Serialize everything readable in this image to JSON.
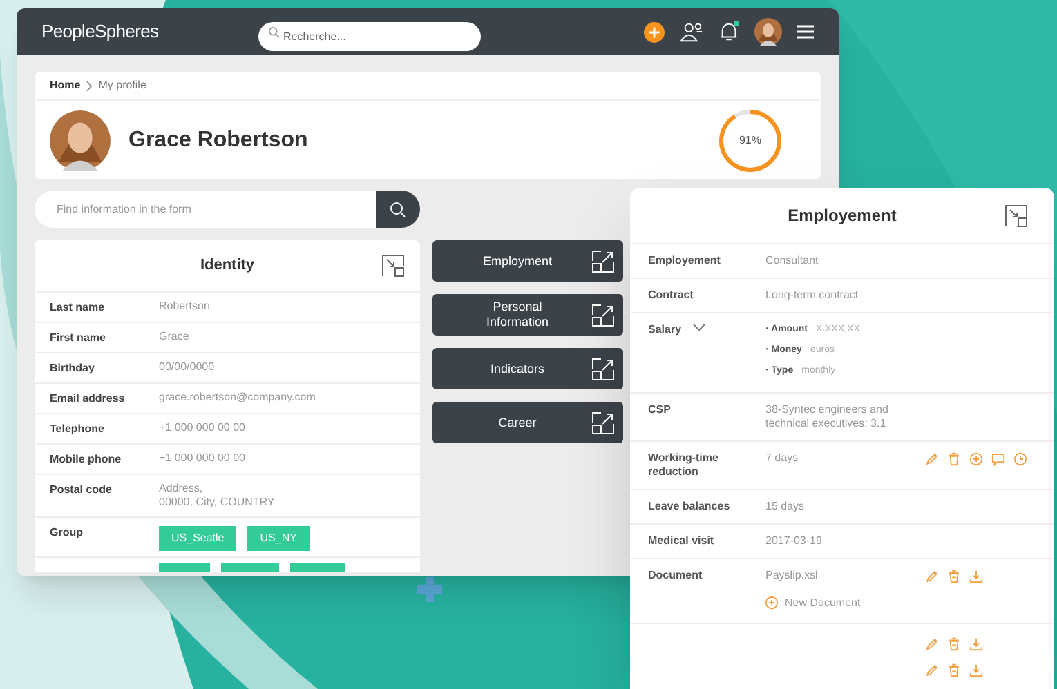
{
  "app": {
    "logo": "PeopleSpheres",
    "search": {
      "placeholder": "Recherche..."
    },
    "notification_dot": true
  },
  "breadcrumb": [
    {
      "label": "Home",
      "current": false
    },
    {
      "label": "My profile",
      "current": true
    }
  ],
  "profile": {
    "name": "Grace Robertson",
    "completion": {
      "level": 0.91,
      "reading": "91%"
    }
  },
  "form_search": {
    "placeholder": "Find information in the form"
  },
  "identity": {
    "title": "Identity",
    "rows": [
      {
        "label": "Last name",
        "value": [
          "Robertson"
        ]
      },
      {
        "label": "First name",
        "value": [
          "Grace"
        ]
      },
      {
        "label": "Birthday",
        "value": [
          "00/00/0000"
        ]
      },
      {
        "label": "Email address",
        "value": [
          "grace.robertson@company.com"
        ]
      },
      {
        "label": "Telephone",
        "value": [
          "+1 000 000 00 00"
        ]
      },
      {
        "label": "Mobile phone",
        "value": [
          "+1 000 000 00 00"
        ]
      },
      {
        "label": "Postal code",
        "value": [
          "Address,",
          "00000, City, COUNTRY"
        ]
      }
    ],
    "group": {
      "label": "Group",
      "tags": [
        "US_Seatle",
        "US_NY"
      ]
    }
  },
  "sections": [
    {
      "label": "Employment"
    },
    {
      "label": "Personal Information"
    },
    {
      "label": "Indicators"
    },
    {
      "label": "Career"
    }
  ],
  "employment_panel": {
    "title": "Employement",
    "rows": [
      {
        "kind": "text",
        "label": "Employement",
        "value": "Consultant"
      },
      {
        "kind": "text",
        "label": "Contract",
        "value": "Long-term contract"
      },
      {
        "kind": "details",
        "label": "Salary",
        "items": [
          {
            "label": "· Amount",
            "value": "X.XXX,XX"
          },
          {
            "label": "· Money",
            "value": "euros"
          },
          {
            "label": "· Type",
            "value": "monthly"
          }
        ]
      },
      {
        "kind": "text",
        "label": "CSP",
        "value": "38-Syntec engineers and technical executives: 3.1"
      },
      {
        "kind": "text",
        "label": "Working-time reduction",
        "value": "7 days",
        "actions": [
          {
            "kind": "edit"
          },
          {
            "kind": "delete"
          },
          {
            "kind": "add"
          },
          {
            "kind": "comment"
          },
          {
            "kind": "history"
          }
        ]
      },
      {
        "kind": "text",
        "label": "Leave balances",
        "value": "15 days"
      },
      {
        "kind": "text",
        "label": "Medical visit",
        "value": "2017-03-19"
      },
      {
        "kind": "document",
        "label": "Document",
        "value": "Payslip.xsl",
        "actions": [
          {
            "kind": "edit"
          },
          {
            "kind": "archive"
          },
          {
            "kind": "download"
          }
        ],
        "new_button": "New Document"
      },
      {
        "kind": "actions",
        "action_lines": [
          [
            {
              "kind": "edit"
            },
            {
              "kind": "archive"
            },
            {
              "kind": "download"
            }
          ],
          [
            {
              "kind": "edit"
            },
            {
              "kind": "archive"
            },
            {
              "kind": "download"
            }
          ]
        ]
      }
    ]
  }
}
